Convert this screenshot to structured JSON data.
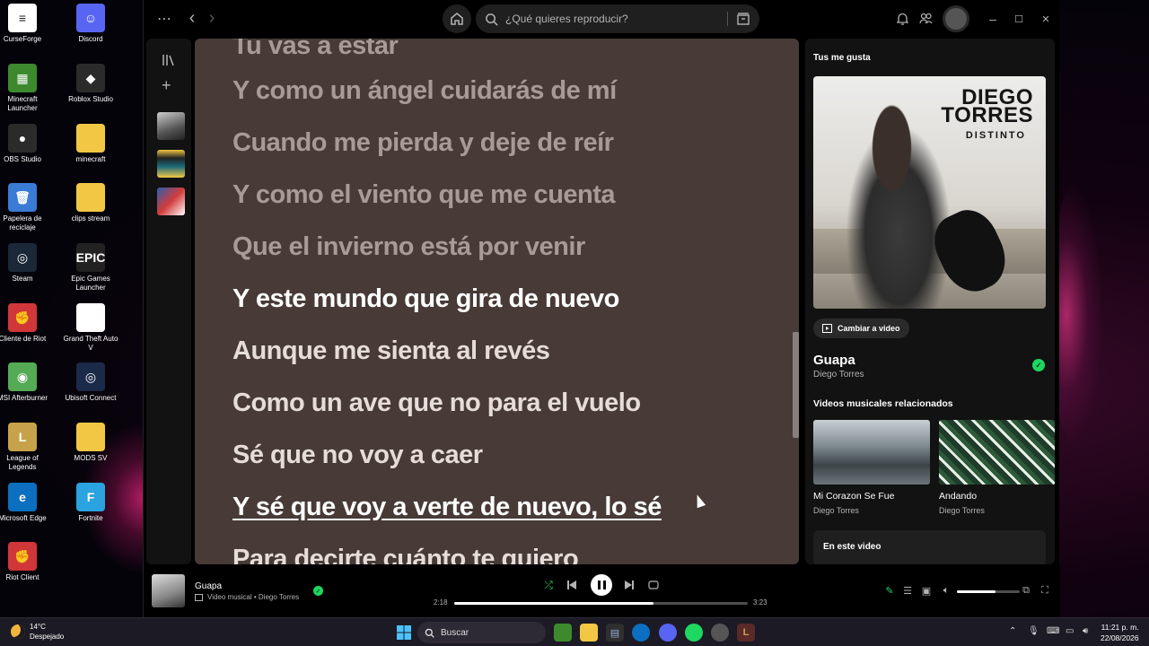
{
  "desktop": {
    "icons": [
      {
        "label": "CurseForge",
        "color": "#ffffff",
        "glyph": "≡"
      },
      {
        "label": "Discord",
        "color": "#5865f2",
        "glyph": "☺"
      },
      {
        "label": "Minecraft Launcher",
        "color": "#3d8a2e",
        "glyph": "▦"
      },
      {
        "label": "Roblox Studio",
        "color": "#2b2b2b",
        "glyph": "◆"
      },
      {
        "label": "OBS Studio",
        "color": "#2b2b2b",
        "glyph": "●"
      },
      {
        "label": "minecraft",
        "color": "#f2c744",
        "glyph": ""
      },
      {
        "label": "Papelera de reciclaje",
        "color": "#3a7bd5",
        "glyph": "🗑"
      },
      {
        "label": "clips stream",
        "color": "#f2c744",
        "glyph": ""
      },
      {
        "label": "Steam",
        "color": "#1b2838",
        "glyph": "◎"
      },
      {
        "label": "Epic Games Launcher",
        "color": "#222222",
        "glyph": "EPIC"
      },
      {
        "label": "Cliente de Riot",
        "color": "#d13639",
        "glyph": "✊"
      },
      {
        "label": "Grand Theft Auto V",
        "color": "#ffffff",
        "glyph": ""
      },
      {
        "label": "MSI Afterburner",
        "color": "#55aa55",
        "glyph": "◉"
      },
      {
        "label": "Ubisoft Connect",
        "color": "#1c2a4a",
        "glyph": "◎"
      },
      {
        "label": "League of Legends",
        "color": "#c8a24a",
        "glyph": "L"
      },
      {
        "label": "MODS SV",
        "color": "#f2c744",
        "glyph": ""
      },
      {
        "label": "Microsoft Edge",
        "color": "#0c6fbf",
        "glyph": "e"
      },
      {
        "label": "Fortnite",
        "color": "#2aa3e0",
        "glyph": "F"
      },
      {
        "label": "Riot Client",
        "color": "#d13639",
        "glyph": "✊"
      }
    ]
  },
  "topbar": {
    "menu_glyph": "⋯",
    "back_glyph": "‹",
    "forward_glyph": "›",
    "search_placeholder": "¿Qué quieres reproducir?",
    "minimize_glyph": "–",
    "maximize_glyph": "☐",
    "close_glyph": "✕"
  },
  "lyrics": {
    "lines": [
      {
        "text": "Tu vas a estar",
        "state": "past"
      },
      {
        "text": "Y como un ángel cuidarás de mí",
        "state": "past"
      },
      {
        "text": "Cuando me pierda y deje de reír",
        "state": "past"
      },
      {
        "text": "Y como el viento que me cuenta",
        "state": "past"
      },
      {
        "text": "Que el invierno está por venir",
        "state": "past"
      },
      {
        "text": "Y este mundo que gira de nuevo",
        "state": "current"
      },
      {
        "text": "Aunque me sienta al revés",
        "state": "upcoming"
      },
      {
        "text": "Como un ave que no para el vuelo",
        "state": "upcoming"
      },
      {
        "text": "Sé que no voy a caer",
        "state": "upcoming"
      },
      {
        "text": "Y sé que voy a verte de nuevo, lo sé",
        "state": "hover"
      },
      {
        "text": "Para decirte cuánto te quiero",
        "state": "upcoming"
      }
    ],
    "background": "#473a37"
  },
  "right_panel": {
    "header": "Tus me gusta",
    "cover_artist": "DIEGO TORRES",
    "cover_album": "DISTINTO",
    "video_button": "Cambiar a video",
    "song_title": "Guapa",
    "song_artist": "Diego Torres",
    "related_header": "Videos musicales relacionados",
    "related": [
      {
        "title": "Mi Corazon Se Fue",
        "artist": "Diego Torres"
      },
      {
        "title": "Andando",
        "artist": "Diego Torres"
      }
    ],
    "in_video": "En este video"
  },
  "player": {
    "title": "Guapa",
    "subtitle": "Video musical • Diego Torres",
    "elapsed": "2:18",
    "duration": "3:23",
    "progress_fraction": 0.68,
    "volume_fraction": 0.62
  },
  "taskbar": {
    "temperature": "14°C",
    "weather": "Despejado",
    "search_label": "Buscar",
    "time": "11:21 p. m.",
    "date": "22/08/2026"
  },
  "colors": {
    "spotify_green": "#1ed760",
    "accent_bg": "#121212"
  }
}
